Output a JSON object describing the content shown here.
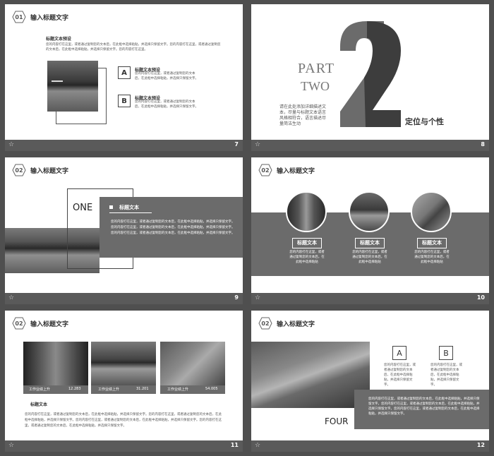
{
  "slides": {
    "s7": {
      "hex": "01",
      "title": "输入标题文字",
      "page": "7",
      "subtitle": "标题文本预设",
      "intro": "您的内容打在这里，或者通过复制您的文本后，在此框中选择粘贴，并选择只保留文字。您的内容打在这里，或者通过复制您的文本后，在此框中选择粘贴，并选择只保留文字。您的内容打在这里。",
      "itemA": {
        "letter": "A",
        "label": "标题文本预设",
        "text": "您的内容打在这里，或者通过复制您的文本后，在此框中选择粘贴，并选择只保留文字。"
      },
      "itemB": {
        "letter": "B",
        "label": "标题文本预设",
        "text": "您的内容打在这里，或者通过复制您的文本后，在此框中选择粘贴，并选择只保留文字。"
      }
    },
    "s8": {
      "page": "8",
      "part": "PART",
      "two": "TWO",
      "digit": "2",
      "body": "请在此处添加详细描述文本，尽量与标题文本语言风格相符合，语言描述尽量简洁生动",
      "caption": "定位与个性"
    },
    "s9": {
      "hex": "02",
      "title": "输入标题文字",
      "page": "9",
      "one": "ONE",
      "label": "标题文本",
      "text": "您的内容打在这里，或者通过复制您的文本后，在此框中选择粘贴，并选择只保留文字。您的内容打在这里，或者通过复制您的文本后，在此框中选择粘贴，并选择只保留文字。您的内容打在这里，或者通过复制您的文本后，在此框中选择粘贴，并选择只保留文字。"
    },
    "s10": {
      "hex": "02",
      "title": "输入标题文字",
      "page": "10",
      "cards": [
        {
          "label": "标题文本",
          "text": "您的内容打在这里，或者通过复制您的文本后，在此框中选择粘贴"
        },
        {
          "label": "标题文本",
          "text": "您的内容打在这里，或者通过复制您的文本后，在此框中选择粘贴"
        },
        {
          "label": "标题文本",
          "text": "您的内容打在这里，或者通过复制您的文本后，在此框中选择粘贴"
        }
      ]
    },
    "s11": {
      "hex": "02",
      "title": "输入标题文字",
      "page": "11",
      "bars": [
        {
          "label": "工作业绩上升",
          "value": "12.283"
        },
        {
          "label": "工作业绩上升",
          "value": "31.201"
        },
        {
          "label": "工作业绩上升",
          "value": "54.005"
        }
      ],
      "subtitle": "标题文本",
      "text": "您的内容打在这里，或者通过复制您的文本后，在此框中选择粘贴，并选择只保留文字。您的内容打在这里，或者通过复制您的文本后，在此框中选择粘贴，并选择只保留文字。您的内容打在这里，或者通过复制您的文本后，在此框中选择粘贴，并选择只保留文字。您的内容打在这里，或者通过复制您的文本后，在此框中选择粘贴，并选择只保留文字。"
    },
    "s12": {
      "hex": "02",
      "title": "输入标题文字",
      "page": "12",
      "a": "A",
      "b": "B",
      "aText": "您的内容打在这里，或者通过复制您的文本后，在此框中选择粘贴，并选择只保留文字。",
      "bText": "您的内容打在这里，或者通过复制您的文本后，在此框中选择粘贴，并选择只保留文字。",
      "four": "FOUR",
      "text": "您的内容打在这里，或者通过复制您的文本后，在此框中选择粘贴，并选择只保留文字。您的内容打在这里，或者通过复制您的文本后，在此框中选择粘贴，并选择只保留文字。您的内容打在这里，或者通过复制您的文本后，在此框中选择粘贴，并选择只保留文字。"
    }
  }
}
